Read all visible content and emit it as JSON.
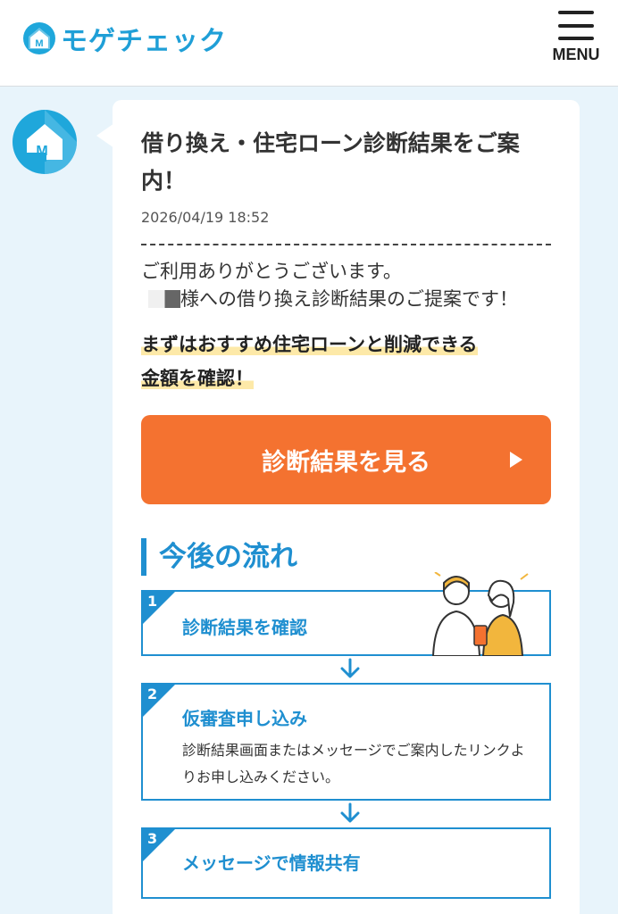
{
  "header": {
    "logo_text": "モゲチェック",
    "menu_label": "MENU"
  },
  "message": {
    "title": "借り換え・住宅ローン診断結果をご案内！",
    "date": "2026/04/19 18:52",
    "greeting": "ご利用ありがとうございます。",
    "proposal_text": "様への借り換え診断結果のご提案です！",
    "highlight_line1": "まずはおすすめ住宅ローンと削減できる",
    "highlight_line2": "金額を確認！",
    "cta_label": "診断結果を見る"
  },
  "flow": {
    "title": "今後の流れ",
    "steps": [
      {
        "num": "1",
        "title": "診断結果を確認",
        "desc": ""
      },
      {
        "num": "2",
        "title": "仮審査申し込み",
        "desc": "診断結果画面またはメッセージでご案内したリンクよりお申し込みください。"
      },
      {
        "num": "3",
        "title": "メッセージで情報共有",
        "desc": ""
      }
    ]
  },
  "colors": {
    "brand_blue": "#1fa7db",
    "cta_orange": "#f47230",
    "highlight_yellow": "#fde9a8",
    "background": "#e8f4fb"
  }
}
